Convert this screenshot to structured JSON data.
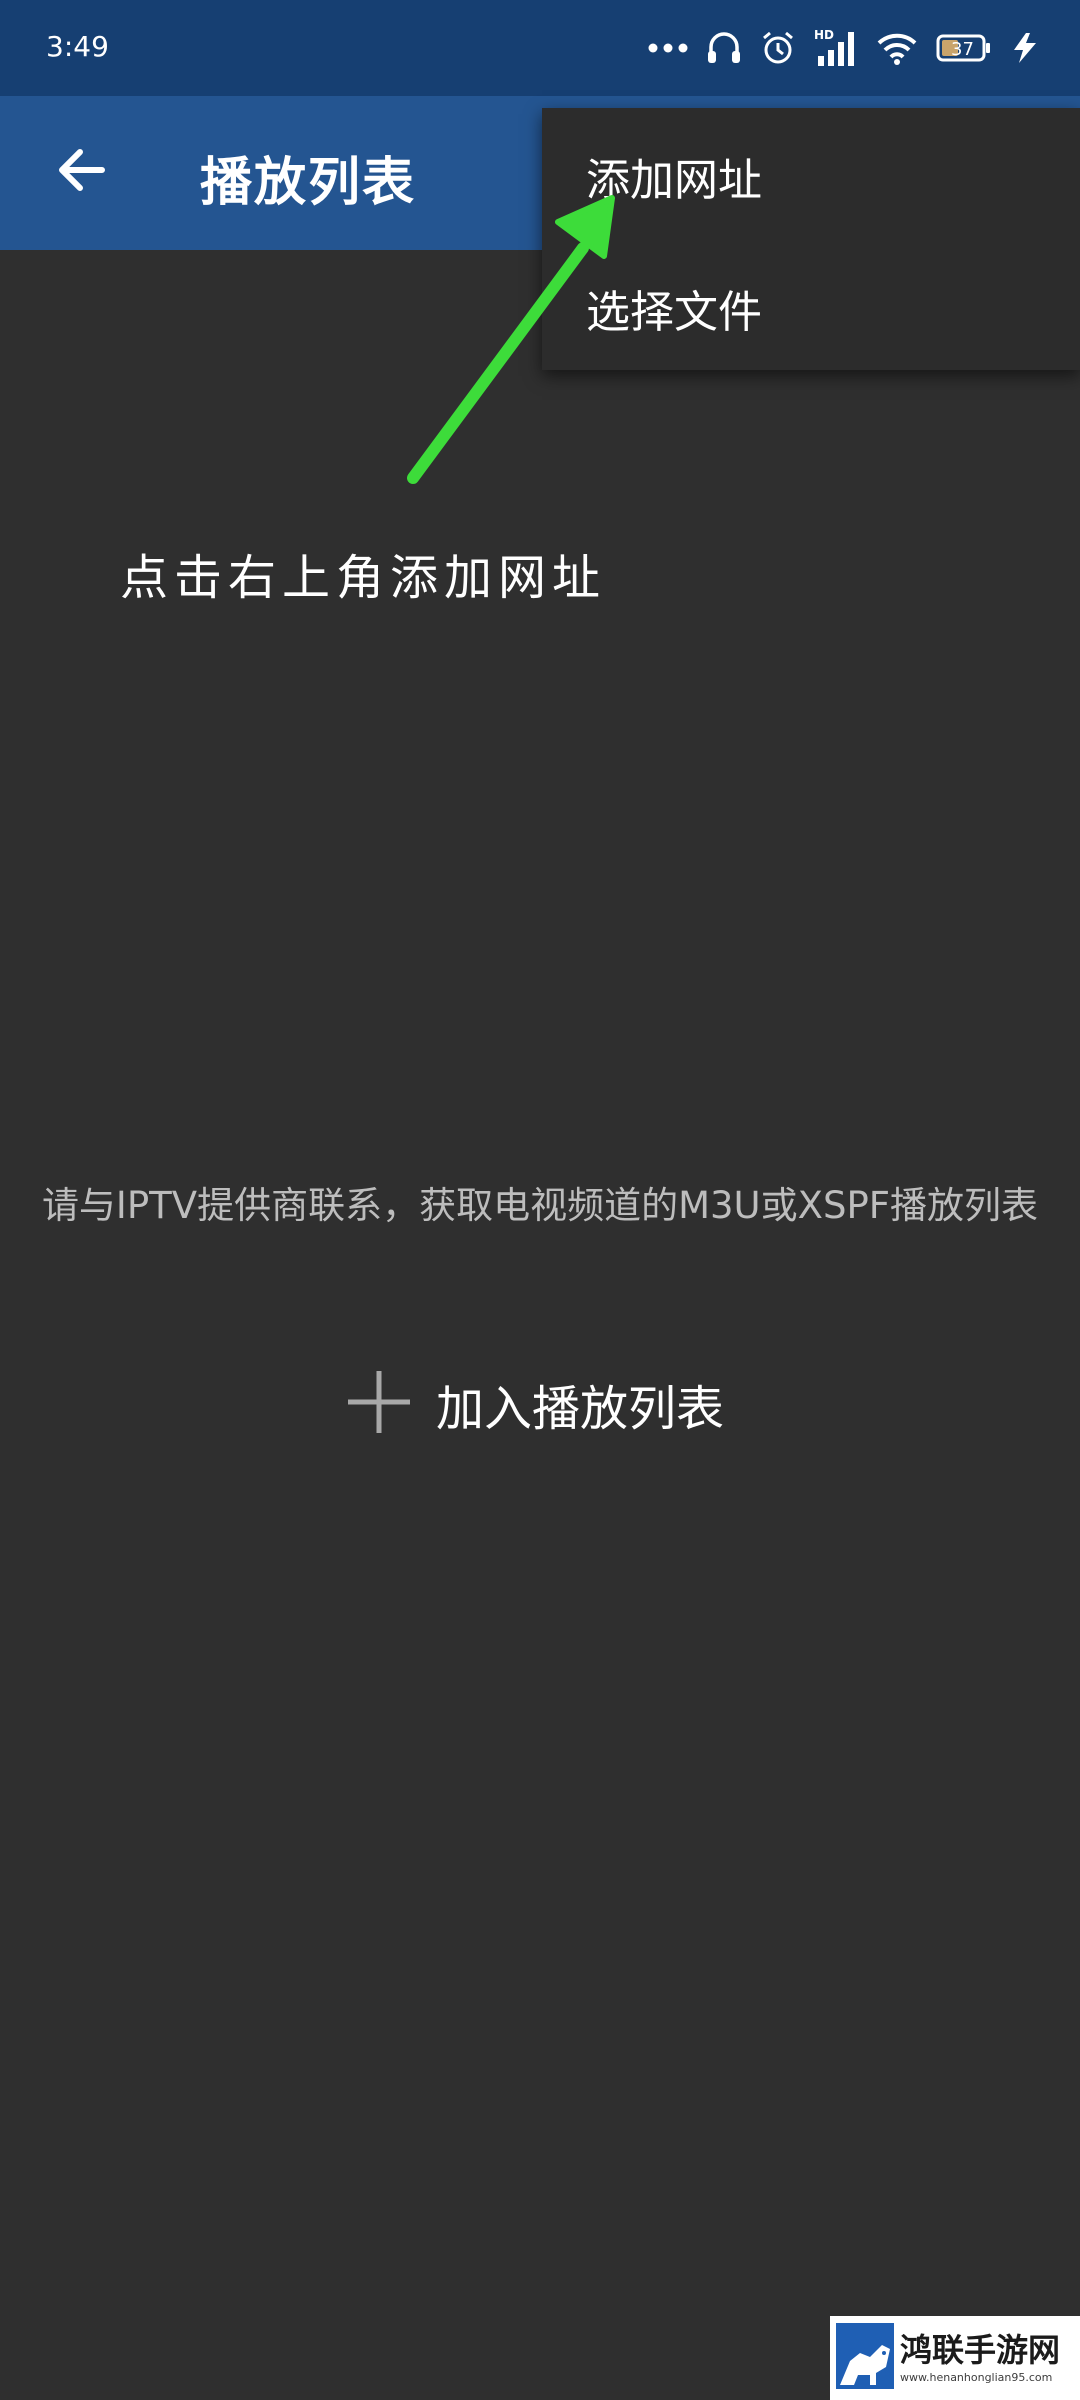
{
  "status_bar": {
    "time": "3:49",
    "network_type": "HD",
    "battery_level": "37",
    "icons": [
      "more-dots-icon",
      "headphones-icon",
      "alarm-icon",
      "signal-icon",
      "wifi-icon",
      "battery-icon",
      "charging-icon"
    ]
  },
  "app_bar": {
    "title": "播放列表",
    "back_icon": "arrow-left-icon"
  },
  "popup_menu": {
    "items": [
      {
        "label": "添加网址"
      },
      {
        "label": "选择文件"
      }
    ]
  },
  "annotation": {
    "text": "点击右上角添加网址",
    "arrow_color": "#3ddc3a"
  },
  "main": {
    "empty_message": "请与IPTV提供商联系，获取电视频道的M3U或XSPF播放列表",
    "add_button_label": "加入播放列表",
    "add_icon": "plus-icon"
  },
  "watermark": {
    "title": "鸿联手游网",
    "url": "www.henanhonglian95.com"
  },
  "colors": {
    "status_bar": "#163f72",
    "app_bar": "#245591",
    "background": "#2f2f2f",
    "menu_background": "#2c2c2c",
    "secondary_text": "#bdbdbd"
  }
}
